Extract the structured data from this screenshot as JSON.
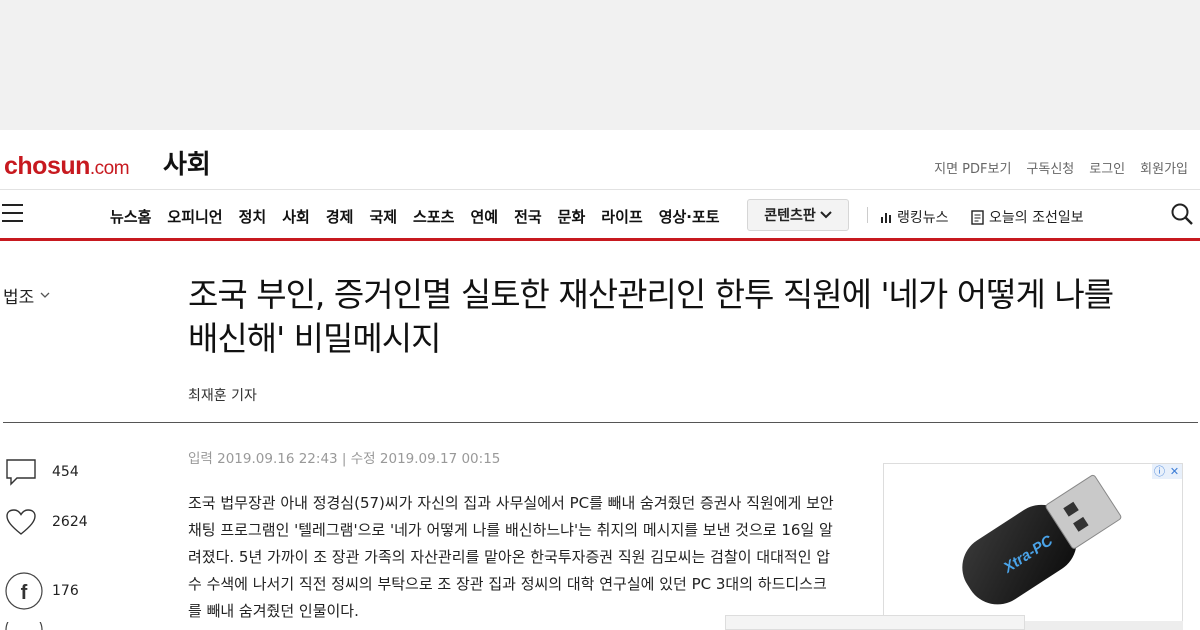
{
  "header": {
    "logo_main": "chosun",
    "logo_suffix": ".com",
    "section": "사회",
    "util_links": [
      "지면 PDF보기",
      "구독신청",
      "로그인",
      "회원가입"
    ]
  },
  "nav": {
    "menu": [
      "뉴스홈",
      "오피니언",
      "정치",
      "사회",
      "경제",
      "국제",
      "스포츠",
      "연예",
      "전국",
      "문화",
      "라이프",
      "영상·포토"
    ],
    "contents_button": "콘텐츠판",
    "ranking": "랭킹뉴스",
    "today_paper": "오늘의 조선일보"
  },
  "article": {
    "category": "법조",
    "title": "조국 부인, 증거인멸 실토한 재산관리인 한투 직원에 '네가 어떻게 나를\n배신해' 비밀메시지",
    "byline": "최재훈 기자",
    "dates": "입력 2019.09.16 22:43 | 수정 2019.09.17 00:15",
    "body": "조국 법무장관 아내 정경심(57)씨가 자신의 집과 사무실에서 PC를 빼내 숨겨줬던 증권사 직원에게 보안채팅 프로그램인 '텔레그램'으로 '네가 어떻게 나를 배신하느냐'는 취지의 메시지를 보낸 것으로 16일 알려졌다. 5년 가까이 조 장관 가족의 자산관리를 맡아온 한국투자증권 직원 김모씨는 검찰이 대대적인 압수 수색에 나서기 직전 정씨의 부탁으로 조 장관 집과 정씨의 대학 연구실에 있던 PC 3대의 하드디스크를 빼내 숨겨줬던 인물이다."
  },
  "share": {
    "comments": "454",
    "likes": "2624",
    "facebook": "176"
  },
  "ad": {
    "brand_text": "Xtra-PC"
  },
  "colors": {
    "accent": "#c7191f",
    "top_band": "#f1f1f1"
  }
}
